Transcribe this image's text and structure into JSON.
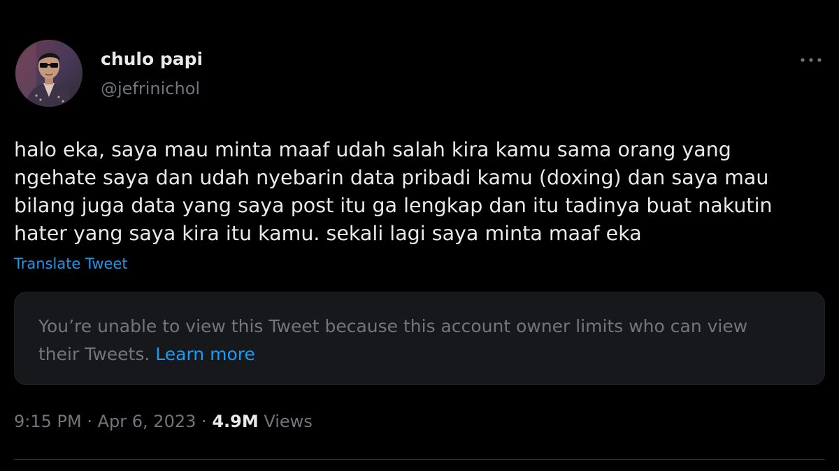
{
  "author": {
    "display_name": "chulo papi",
    "handle": "@jefrinichol",
    "avatar_icon": "profile-photo"
  },
  "more_icon": "more-options-icon",
  "tweet": {
    "text_lines": [
      "halo eka, saya mau minta maaf udah salah kira kamu sama orang yang",
      "ngehate saya dan udah nyebarin data pribadi kamu (doxing) dan saya mau",
      "bilang juga data yang saya post itu ga lengkap dan itu tadinya buat nakutin",
      "hater yang saya kira itu kamu. sekali lagi saya minta maaf eka"
    ],
    "translate_label": "Translate Tweet"
  },
  "quoted_tweet": {
    "notice_line1": "You’re unable to view this Tweet because this account owner limits who can view",
    "notice_line2": "their Tweets.",
    "learn_more_label": "Learn more"
  },
  "meta": {
    "time": "9:15 PM",
    "separator": "·",
    "date": "Apr 6, 2023",
    "views_count": "4.9M",
    "views_label": "Views"
  },
  "colors": {
    "background": "#000000",
    "primary_text": "#e7e9ea",
    "secondary_text": "#71767b",
    "link": "#1d9bf0",
    "card_background": "#16181c"
  }
}
